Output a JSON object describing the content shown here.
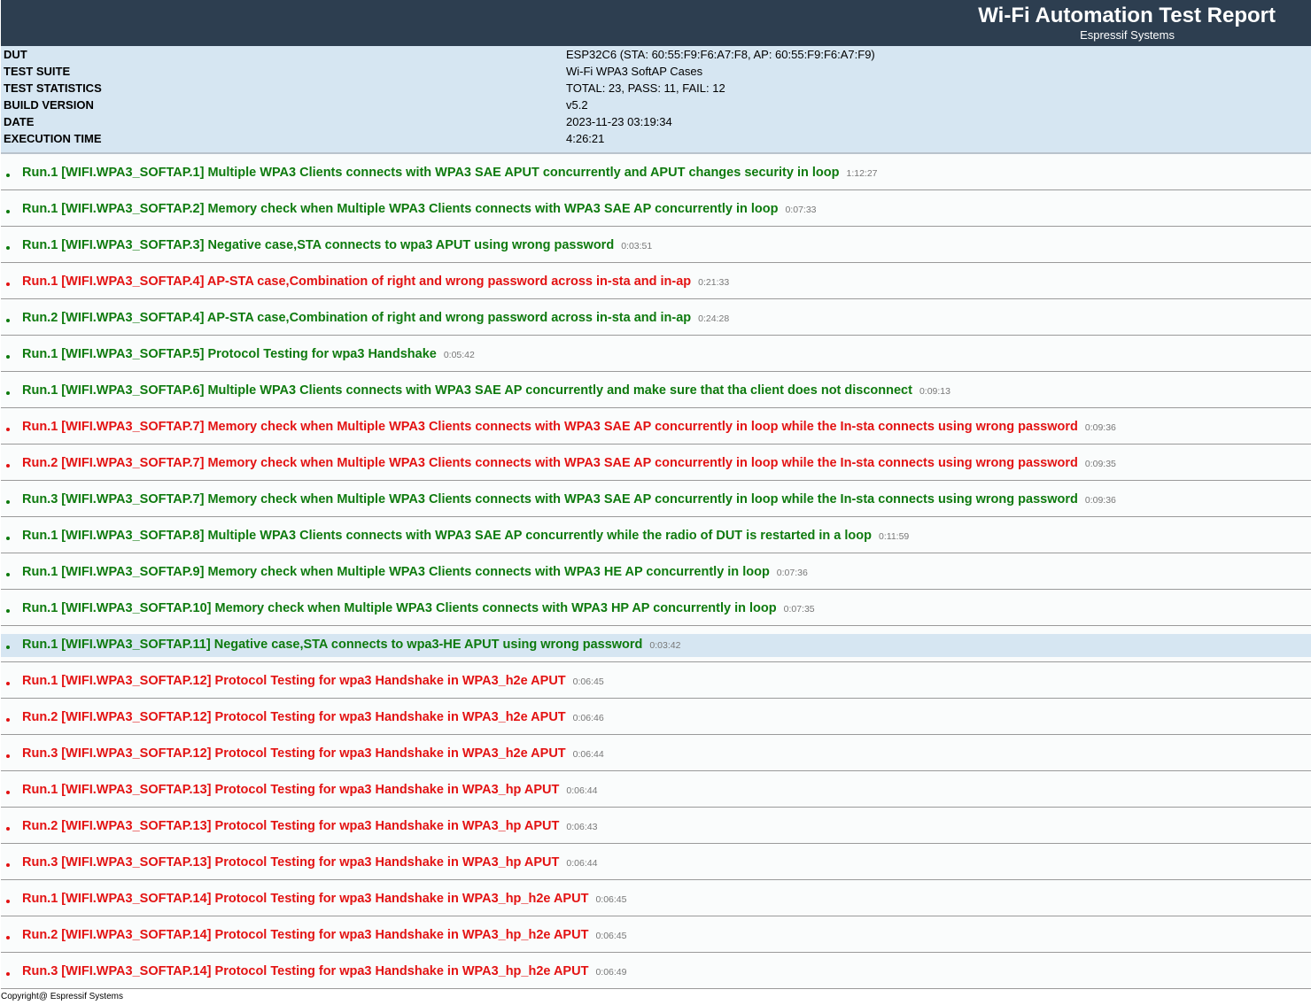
{
  "header": {
    "title": "Wi-Fi Automation Test Report",
    "subtitle": "Espressif Systems",
    "background": "#2d3e50"
  },
  "info": [
    {
      "label": "DUT",
      "value": "ESP32C6 (STA: 60:55:F9:F6:A7:F8, AP: 60:55:F9:F6:A7:F9)"
    },
    {
      "label": "TEST SUITE",
      "value": "Wi-Fi WPA3 SoftAP Cases"
    },
    {
      "label": "TEST STATISTICS",
      "value": "TOTAL: 23, PASS: 11, FAIL: 12"
    },
    {
      "label": "BUILD VERSION",
      "value": "v5.2"
    },
    {
      "label": "DATE",
      "value": "2023-11-23 03:19:34"
    },
    {
      "label": "EXECUTION TIME",
      "value": "4:26:21"
    }
  ],
  "colors": {
    "pass": "#0e7a0e",
    "fail": "#e31212",
    "info_bg": "#d6e6f2"
  },
  "tests": [
    {
      "status": "pass",
      "text": "Run.1 [WIFI.WPA3_SOFTAP.1] Multiple WPA3 Clients connects with WPA3 SAE APUT concurrently and APUT changes security in loop",
      "time": "1:12:27"
    },
    {
      "status": "pass",
      "text": "Run.1 [WIFI.WPA3_SOFTAP.2] Memory check when Multiple WPA3 Clients connects with WPA3 SAE AP concurrently in loop",
      "time": "0:07:33"
    },
    {
      "status": "pass",
      "text": "Run.1 [WIFI.WPA3_SOFTAP.3] Negative case,STA connects to wpa3 APUT using wrong password",
      "time": "0:03:51"
    },
    {
      "status": "fail",
      "text": "Run.1 [WIFI.WPA3_SOFTAP.4] AP-STA case,Combination of right and wrong password across in-sta and in-ap",
      "time": "0:21:33"
    },
    {
      "status": "pass",
      "text": "Run.2 [WIFI.WPA3_SOFTAP.4] AP-STA case,Combination of right and wrong password across in-sta and in-ap",
      "time": "0:24:28"
    },
    {
      "status": "pass",
      "text": "Run.1 [WIFI.WPA3_SOFTAP.5] Protocol Testing for wpa3 Handshake",
      "time": "0:05:42"
    },
    {
      "status": "pass",
      "text": "Run.1 [WIFI.WPA3_SOFTAP.6] Multiple WPA3 Clients connects with WPA3 SAE AP concurrently and make sure that tha client does not disconnect",
      "time": "0:09:13"
    },
    {
      "status": "fail",
      "text": "Run.1 [WIFI.WPA3_SOFTAP.7] Memory check when Multiple WPA3 Clients connects with WPA3 SAE AP concurrently in loop while the In-sta connects using wrong password",
      "time": "0:09:36"
    },
    {
      "status": "fail",
      "text": "Run.2 [WIFI.WPA3_SOFTAP.7] Memory check when Multiple WPA3 Clients connects with WPA3 SAE AP concurrently in loop while the In-sta connects using wrong password",
      "time": "0:09:35"
    },
    {
      "status": "pass",
      "text": "Run.3 [WIFI.WPA3_SOFTAP.7] Memory check when Multiple WPA3 Clients connects with WPA3 SAE AP concurrently in loop while the In-sta connects using wrong password",
      "time": "0:09:36"
    },
    {
      "status": "pass",
      "text": "Run.1 [WIFI.WPA3_SOFTAP.8] Multiple WPA3 Clients connects with WPA3 SAE AP concurrently while the radio of DUT is restarted in a loop",
      "time": "0:11:59"
    },
    {
      "status": "pass",
      "text": "Run.1 [WIFI.WPA3_SOFTAP.9] Memory check when Multiple WPA3 Clients connects with WPA3 HE AP concurrently in loop",
      "time": "0:07:36"
    },
    {
      "status": "pass",
      "text": "Run.1 [WIFI.WPA3_SOFTAP.10] Memory check when Multiple WPA3 Clients connects with WPA3 HP AP concurrently in loop",
      "time": "0:07:35"
    },
    {
      "status": "pass",
      "selected": true,
      "text": "Run.1 [WIFI.WPA3_SOFTAP.11] Negative case,STA connects to wpa3-HE APUT using wrong password",
      "time": "0:03:42"
    },
    {
      "status": "fail",
      "text": "Run.1 [WIFI.WPA3_SOFTAP.12] Protocol Testing for wpa3 Handshake in WPA3_h2e APUT",
      "time": "0:06:45"
    },
    {
      "status": "fail",
      "text": "Run.2 [WIFI.WPA3_SOFTAP.12] Protocol Testing for wpa3 Handshake in WPA3_h2e APUT",
      "time": "0:06:46"
    },
    {
      "status": "fail",
      "text": "Run.3 [WIFI.WPA3_SOFTAP.12] Protocol Testing for wpa3 Handshake in WPA3_h2e APUT",
      "time": "0:06:44"
    },
    {
      "status": "fail",
      "text": "Run.1 [WIFI.WPA3_SOFTAP.13] Protocol Testing for wpa3 Handshake in WPA3_hp APUT",
      "time": "0:06:44"
    },
    {
      "status": "fail",
      "text": "Run.2 [WIFI.WPA3_SOFTAP.13] Protocol Testing for wpa3 Handshake in WPA3_hp APUT",
      "time": "0:06:43"
    },
    {
      "status": "fail",
      "text": "Run.3 [WIFI.WPA3_SOFTAP.13] Protocol Testing for wpa3 Handshake in WPA3_hp APUT",
      "time": "0:06:44"
    },
    {
      "status": "fail",
      "text": "Run.1 [WIFI.WPA3_SOFTAP.14] Protocol Testing for wpa3 Handshake in WPA3_hp_h2e APUT",
      "time": "0:06:45"
    },
    {
      "status": "fail",
      "text": "Run.2 [WIFI.WPA3_SOFTAP.14] Protocol Testing for wpa3 Handshake in WPA3_hp_h2e APUT",
      "time": "0:06:45"
    },
    {
      "status": "fail",
      "text": "Run.3 [WIFI.WPA3_SOFTAP.14] Protocol Testing for wpa3 Handshake in WPA3_hp_h2e APUT",
      "time": "0:06:49"
    }
  ],
  "footer": "Copyright@ Espressif Systems"
}
